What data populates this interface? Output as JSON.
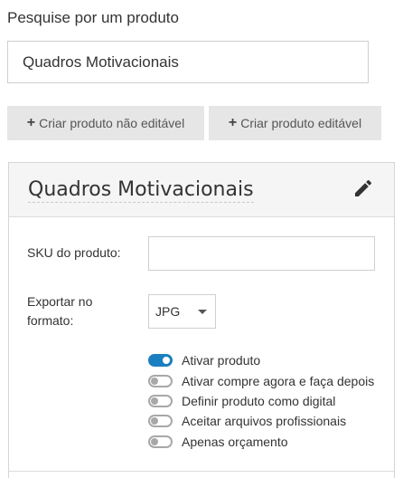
{
  "search": {
    "label": "Pesquise por um produto",
    "value": "Quadros Motivacionais",
    "placeholder": ""
  },
  "actions": {
    "create_non_editable": "Criar produto não editável",
    "create_editable": "Criar produto editável",
    "plus_icon": "plus-icon"
  },
  "product": {
    "title": "Quadros Motivacionais",
    "edit_icon": "pencil-icon",
    "sku_label": "SKU do produto:",
    "sku_value": "",
    "export_label": "Exportar no formato:",
    "export_format": "JPG",
    "toggles": [
      {
        "label": "Ativar produto",
        "on": true
      },
      {
        "label": "Ativar compre agora e faça depois",
        "on": false
      },
      {
        "label": "Definir produto como digital",
        "on": false
      },
      {
        "label": "Aceitar arquivos profissionais",
        "on": false
      },
      {
        "label": "Apenas orçamento",
        "on": false
      }
    ]
  },
  "colors": {
    "accent": "#1a7fc1",
    "button_bg": "#e6e6e6",
    "header_bg": "#f5f5f5"
  }
}
